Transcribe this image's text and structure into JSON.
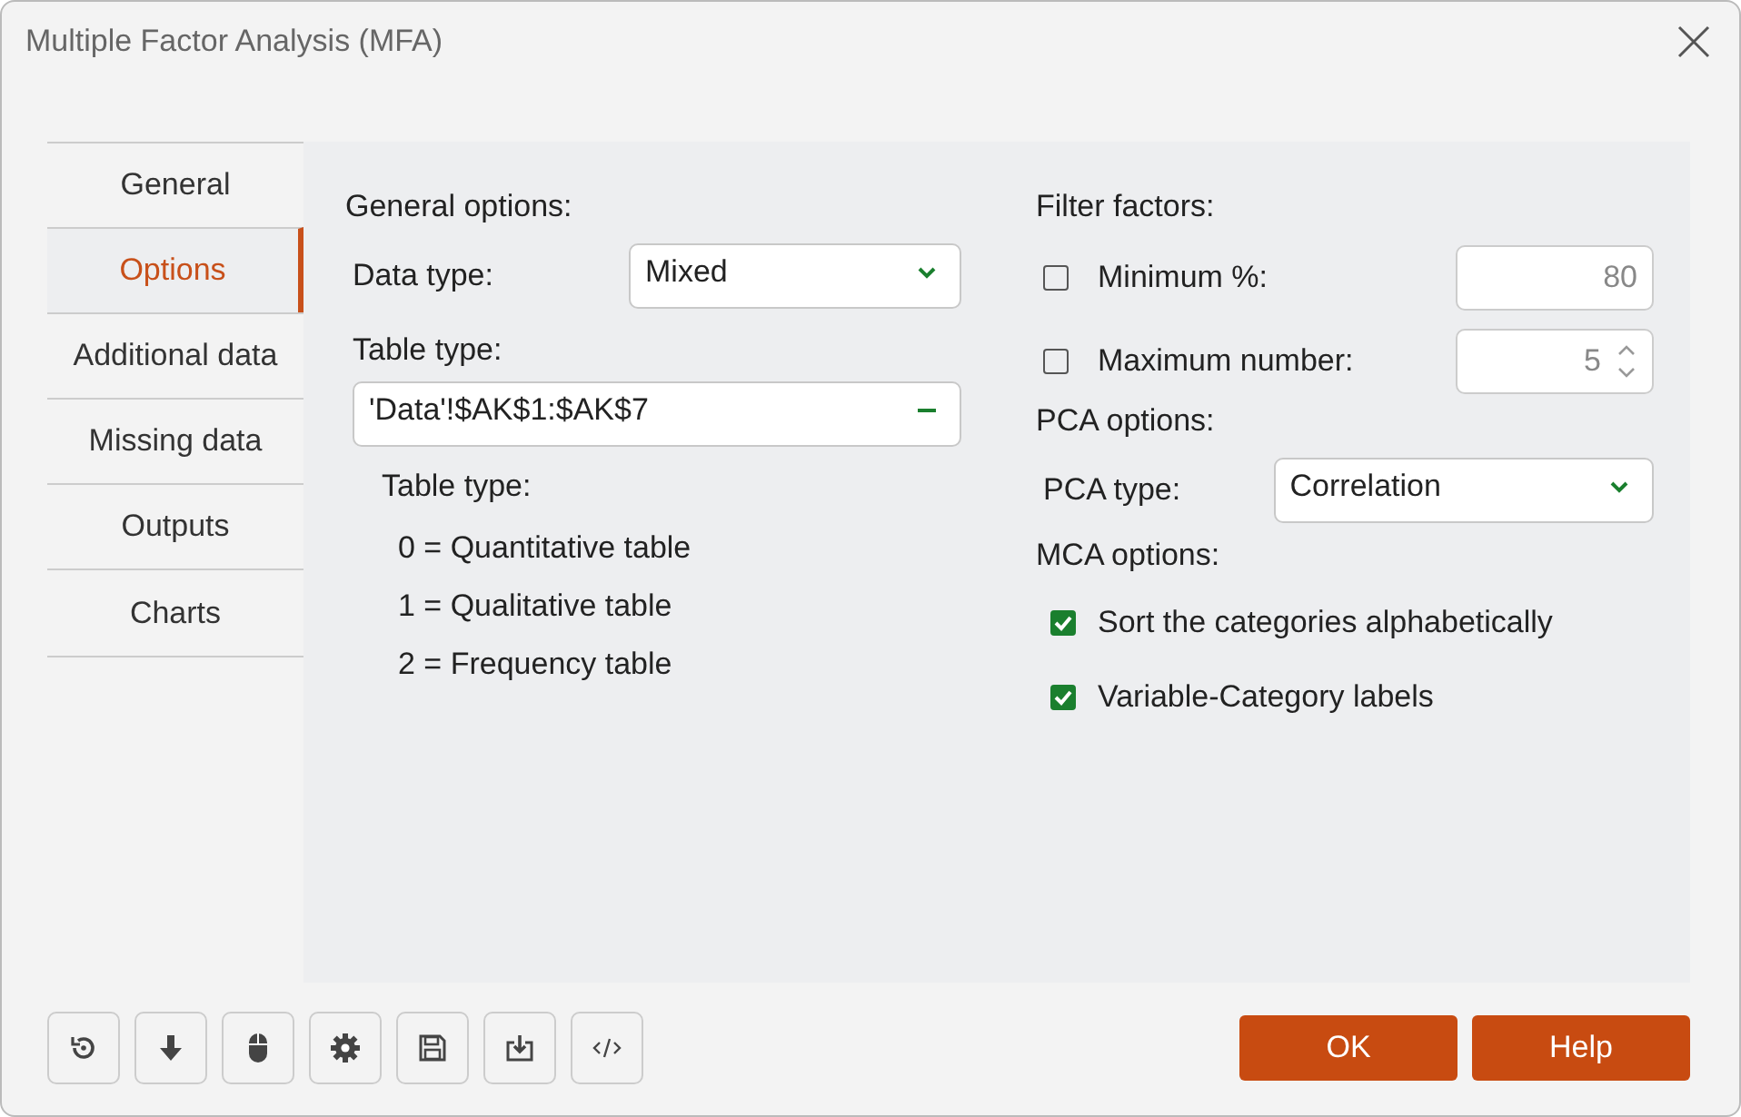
{
  "window": {
    "title": "Multiple Factor Analysis (MFA)"
  },
  "tabs": [
    {
      "label": "General",
      "selected": false
    },
    {
      "label": "Options",
      "selected": true
    },
    {
      "label": "Additional data",
      "selected": false
    },
    {
      "label": "Missing data",
      "selected": false
    },
    {
      "label": "Outputs",
      "selected": false
    },
    {
      "label": "Charts",
      "selected": false
    }
  ],
  "general_options": {
    "heading": "General options:",
    "data_type": {
      "label": "Data type:",
      "value": "Mixed"
    },
    "table_type": {
      "label": "Table type:",
      "value": "'Data'!$AK$1:$AK$7"
    },
    "legend": {
      "title": "Table type:",
      "lines": [
        "0 = Quantitative table",
        "1 = Qualitative table",
        "2 = Frequency table"
      ]
    }
  },
  "filter_factors": {
    "heading": "Filter factors:",
    "items": [
      {
        "kind": "plain",
        "label": "Minimum %:",
        "checked": false,
        "disabled": true,
        "value": "80"
      },
      {
        "kind": "spin",
        "label": "Maximum number:",
        "checked": false,
        "disabled": true,
        "value": "5"
      }
    ]
  },
  "pca_options": {
    "heading": "PCA options:",
    "label": "PCA type:",
    "value": "Correlation"
  },
  "mca_options": {
    "heading": "MCA options:",
    "items": [
      {
        "label": "Sort the categories alphabetically",
        "checked": true
      },
      {
        "label": "Variable-Category labels",
        "checked": true
      }
    ]
  },
  "toolbar": [
    {
      "kind": "reset"
    },
    {
      "kind": "down"
    },
    {
      "kind": "mouse"
    },
    {
      "kind": "gear"
    },
    {
      "kind": "save"
    },
    {
      "kind": "import"
    },
    {
      "kind": "code"
    }
  ],
  "buttons": [
    {
      "label": "OK"
    },
    {
      "label": "Help"
    }
  ]
}
